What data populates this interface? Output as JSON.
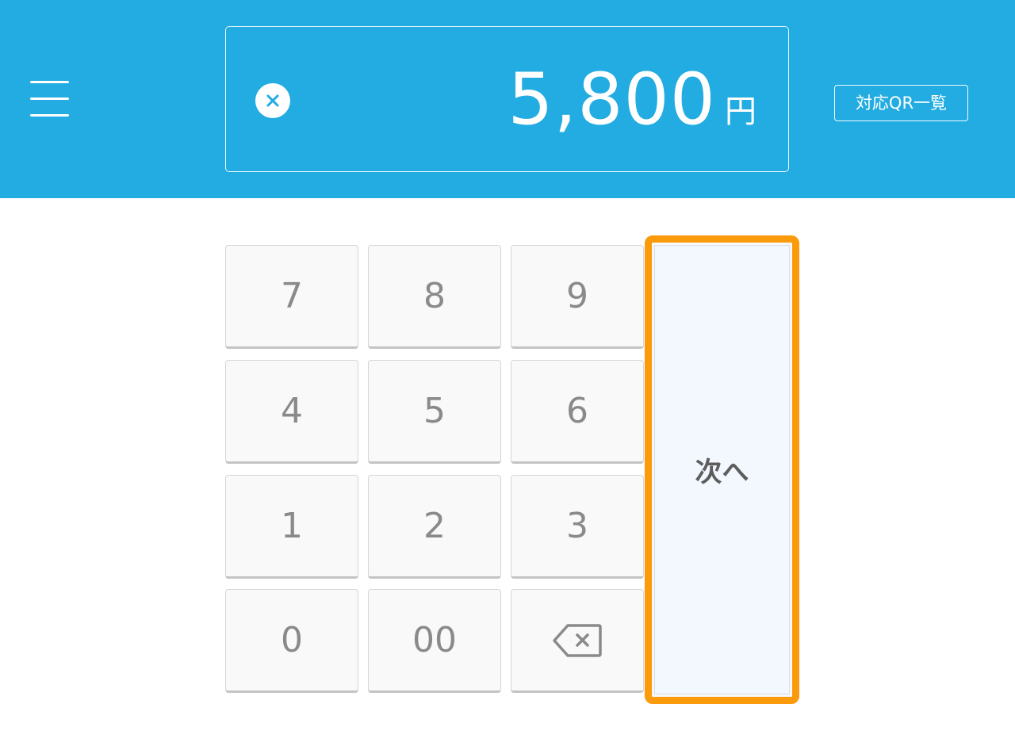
{
  "header": {
    "menu_icon": "hamburger-menu-icon",
    "clear_icon": "clear-circle-icon",
    "amount": "5,800",
    "currency": "円",
    "qr_list_label": "対応QR一覧"
  },
  "keypad": {
    "keys": [
      "7",
      "8",
      "9",
      "4",
      "5",
      "6",
      "1",
      "2",
      "3",
      "0",
      "00"
    ],
    "backspace_icon": "backspace-icon",
    "next_label": "次へ"
  },
  "colors": {
    "header_bg": "#22ace1",
    "highlight_border": "#fb9a0a",
    "key_bg": "#f9f9f9",
    "next_bg": "#f2f8fe"
  }
}
